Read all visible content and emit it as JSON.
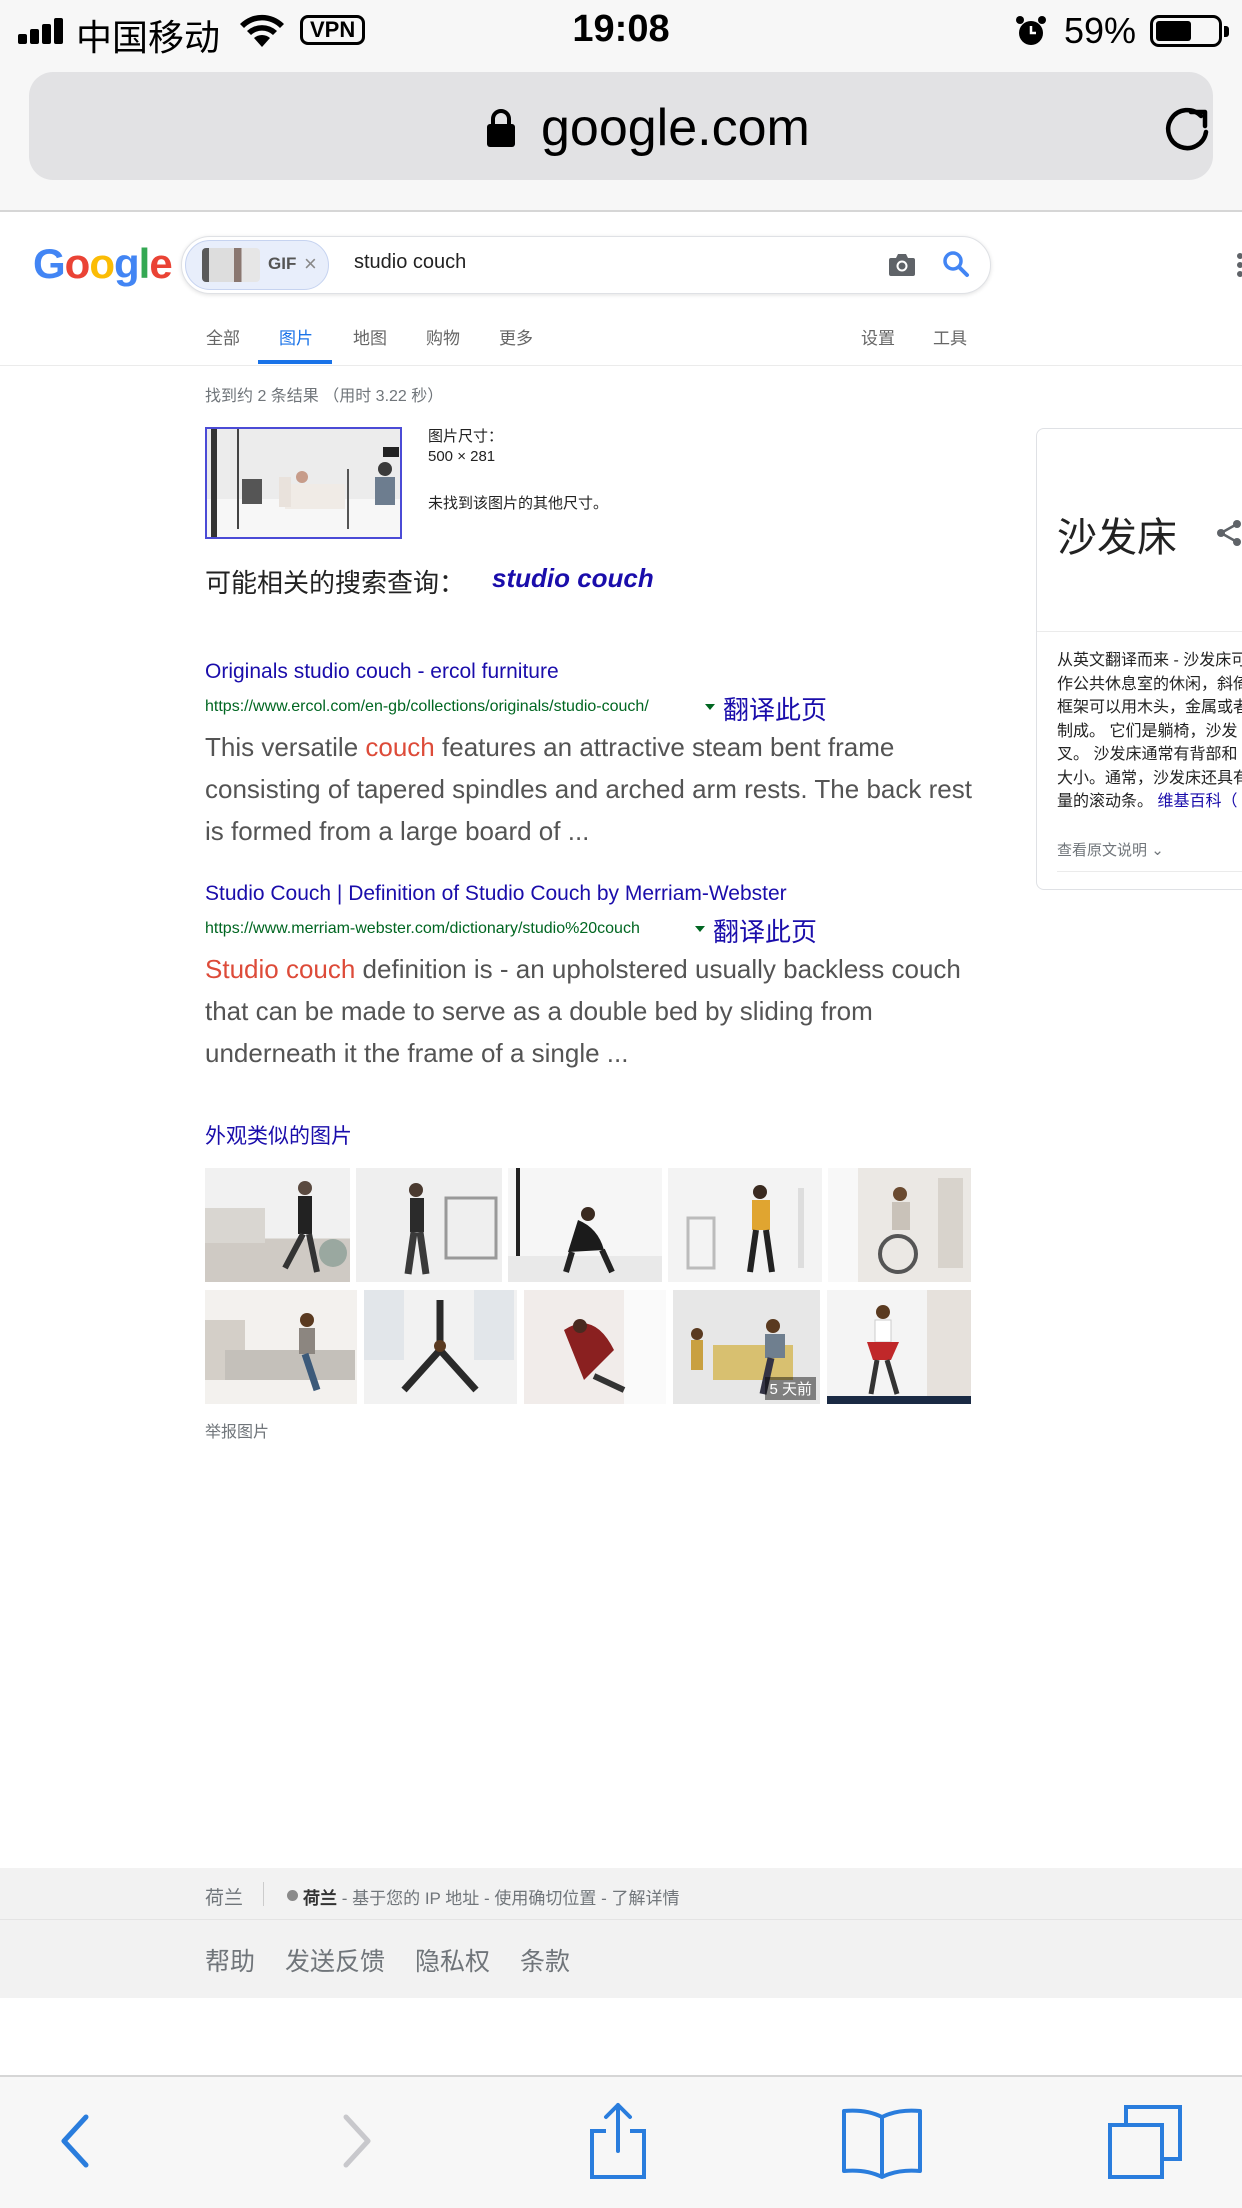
{
  "status_bar": {
    "carrier": "中国移动",
    "vpn": "VPN",
    "time": "19:08",
    "battery_percent": "59%",
    "battery_level": 0.59
  },
  "browser": {
    "address": "google.com",
    "icons": [
      "lock-icon",
      "reload-icon"
    ]
  },
  "google": {
    "logo_letters": [
      "G",
      "o",
      "o",
      "g",
      "l",
      "e"
    ],
    "logo_colors": [
      "#4285f4",
      "#ea4335",
      "#fbbc05",
      "#4285f4",
      "#34a853",
      "#ea4335"
    ],
    "gif_chip_label": "GIF",
    "gif_chip_close": "×",
    "query": "studio couch",
    "tabs": [
      "全部",
      "图片",
      "地图",
      "购物",
      "更多"
    ],
    "active_tab": "图片",
    "right_tabs": [
      "设置",
      "工具"
    ],
    "result_stats": "找到约 2 条结果 （用时 3.22 秒）",
    "image_info": {
      "size_label": "图片尺寸：",
      "size_value": "500 × 281",
      "note": "未找到该图片的其他尺寸。"
    },
    "related": {
      "label": "可能相关的搜索查询：",
      "query": "studio couch"
    },
    "results": [
      {
        "title": "Originals studio couch - ercol furniture",
        "url": "https://www.ercol.com/en-gb/collections/originals/studio-couch/",
        "translate": "翻译此页",
        "snippet_highlight": "",
        "snippet_pre": "This versatile ",
        "snippet_hl": "couch",
        "snippet_post": " features an attractive steam bent frame consisting of tapered spindles and arched arm rests. The back rest is formed from a large board of ..."
      },
      {
        "title": "Studio Couch | Definition of Studio Couch by Merriam-Webster",
        "url": "https://www.merriam-webster.com/dictionary/studio%20couch",
        "translate": "翻译此页",
        "snippet_pre": "",
        "snippet_hl": "Studio couch",
        "snippet_post": " definition is - an upholstered usually backless couch that can be made to serve as a double bed by sliding from underneath it the frame of a single  ..."
      }
    ],
    "similar_title": "外观类似的图片",
    "similar_badge": "5 天前",
    "report_images": "举报图片"
  },
  "knowledge_panel": {
    "title": "沙发床",
    "description_lines": [
      "从英文翻译而来 - 沙发床可",
      "作公共休息室的休闲，斜倚",
      "框架可以用木头，金属或者",
      "制成。 它们是躺椅，沙发",
      "叉。 沙发床通常有背部和",
      "大小。通常，沙发床还具有",
      "量的滚动条。"
    ],
    "wiki_link": "维基百科（",
    "more": "查看原文说明"
  },
  "footer": {
    "country": "荷兰",
    "location_bold": "荷兰",
    "location_text": " - 基于您的 IP 地址 - 使用确切位置 - 了解详情",
    "links": [
      "帮助",
      "发送反馈",
      "隐私权",
      "条款"
    ]
  },
  "toolbar": {
    "icons": [
      "back-icon",
      "forward-icon",
      "share-icon",
      "bookmarks-icon",
      "tabs-icon"
    ]
  },
  "colors": {
    "link_blue": "#1a0dab",
    "url_green": "#006621",
    "highlight_red": "#dd4b39",
    "active_tab_blue": "#1a73e8",
    "ios_blue": "#2a7ddd"
  }
}
